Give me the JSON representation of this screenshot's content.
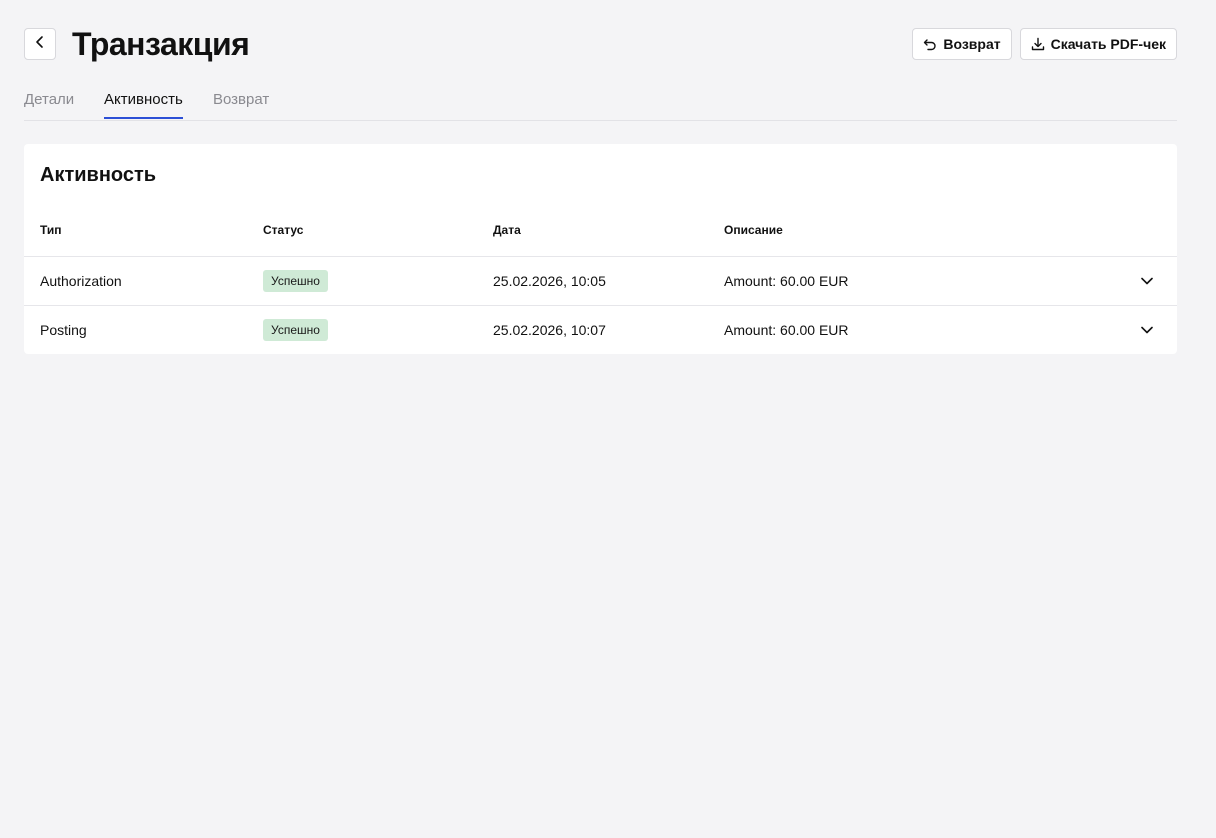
{
  "header": {
    "title": "Транзакция",
    "back_icon": "chevron-left-icon",
    "actions": [
      {
        "label": "Возврат",
        "icon": "undo-icon"
      },
      {
        "label": "Скачать PDF-чек",
        "icon": "download-icon"
      }
    ]
  },
  "tabs": [
    {
      "label": "Детали",
      "active": false
    },
    {
      "label": "Активность",
      "active": true
    },
    {
      "label": "Возврат",
      "active": false
    }
  ],
  "activity": {
    "title": "Активность",
    "columns": [
      "Тип",
      "Статус",
      "Дата",
      "Описание"
    ],
    "rows": [
      {
        "type": "Authorization",
        "status": "Успешно",
        "date": "25.02.2026, 10:05",
        "description": "Amount: 60.00 EUR"
      },
      {
        "type": "Posting",
        "status": "Успешно",
        "date": "25.02.2026, 10:07",
        "description": "Amount: 60.00 EUR"
      }
    ]
  },
  "colors": {
    "background": "#f4f4f6",
    "card": "#ffffff",
    "accent": "#2c4fd6",
    "success_badge": "#cfead6",
    "muted_text": "#8a8a90"
  }
}
